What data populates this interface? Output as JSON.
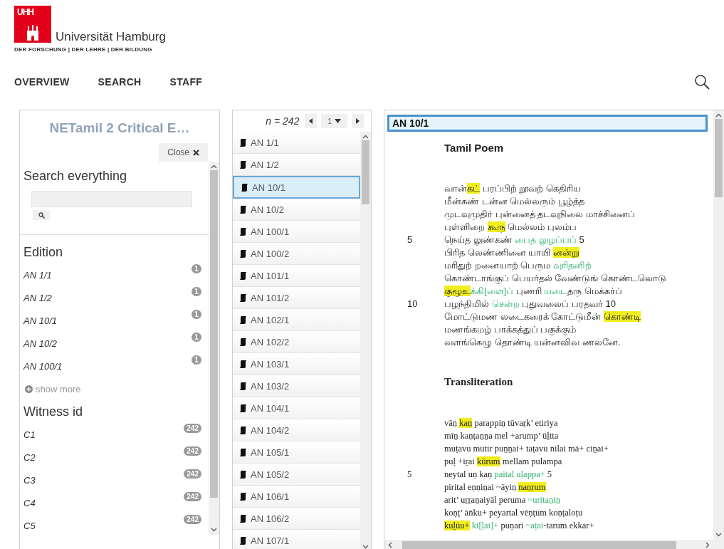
{
  "header": {
    "logo_mark": "UHH",
    "university": "Universität Hamburg",
    "tagline": "DER FORSCHUNG | DER LEHRE | DER BILDUNG"
  },
  "nav": [
    "OVERVIEW",
    "SEARCH",
    "STAFF"
  ],
  "sidebar": {
    "title": "NETamil 2 Critical E…",
    "close": "Close",
    "search_heading": "Search everything",
    "facets": [
      {
        "title": "Edition",
        "show_more": "show more",
        "items": [
          {
            "label": "AN 1/1",
            "count": "1"
          },
          {
            "label": "AN 1/2",
            "count": "1"
          },
          {
            "label": "AN 10/1",
            "count": "1"
          },
          {
            "label": "AN 10/2",
            "count": "1"
          },
          {
            "label": "AN 100/1",
            "count": "1"
          }
        ]
      },
      {
        "title": "Witness id",
        "items": [
          {
            "label": "C1",
            "count": "242"
          },
          {
            "label": "C2",
            "count": "242"
          },
          {
            "label": "C3",
            "count": "242"
          },
          {
            "label": "C4",
            "count": "242"
          },
          {
            "label": "C5",
            "count": "242"
          }
        ]
      }
    ]
  },
  "list": {
    "count": "n = 242",
    "page": "1",
    "items": [
      {
        "label": "AN 1/1",
        "selected": false
      },
      {
        "label": "AN 1/2",
        "selected": false
      },
      {
        "label": "AN 10/1",
        "selected": true
      },
      {
        "label": "AN 10/2",
        "selected": false
      },
      {
        "label": "AN 100/1",
        "selected": false
      },
      {
        "label": "AN 100/2",
        "selected": false
      },
      {
        "label": "AN 101/1",
        "selected": false
      },
      {
        "label": "AN 101/2",
        "selected": false
      },
      {
        "label": "AN 102/1",
        "selected": false
      },
      {
        "label": "AN 102/2",
        "selected": false
      },
      {
        "label": "AN 103/1",
        "selected": false
      },
      {
        "label": "AN 103/2",
        "selected": false
      },
      {
        "label": "AN 104/1",
        "selected": false
      },
      {
        "label": "AN 104/2",
        "selected": false
      },
      {
        "label": "AN 105/1",
        "selected": false
      },
      {
        "label": "AN 105/2",
        "selected": false
      },
      {
        "label": "AN 106/1",
        "selected": false
      },
      {
        "label": "AN 106/2",
        "selected": false
      },
      {
        "label": "AN 107/1",
        "selected": false
      }
    ]
  },
  "document": {
    "title": "AN 10/1",
    "sections": [
      {
        "heading": "Tamil Poem",
        "kind": "tamil",
        "lines": [
          {
            "segments": [
              {
                "kind": "plain",
                "text": "வான்"
              },
              {
                "kind": "highlight",
                "text": "கட்"
              },
              {
                "kind": "plain",
                "text": " பரப்பிற் றூவற் கெதிரிய"
              }
            ]
          },
          {
            "segments": [
              {
                "kind": "plain",
                "text": "மீன்கண் டன்ன மெல்லரும் பூழ்த்த"
              }
            ]
          },
          {
            "segments": [
              {
                "kind": "plain",
                "text": "முடவுமுதிர் புன்னைத் தடவுநிலை மாச்சினைப்"
              }
            ]
          },
          {
            "segments": [
              {
                "kind": "plain",
                "text": "புள்ளிறை "
              },
              {
                "kind": "highlight",
                "text": "கூரு"
              },
              {
                "kind": "plain",
                "text": " மெல்லம் புலம்ப"
              }
            ]
          },
          {
            "number": "5",
            "segments": [
              {
                "kind": "plain",
                "text": "நெய்த லுண்கண் "
              },
              {
                "kind": "variant",
                "text": "பைத லுழப்பப்"
              },
              {
                "kind": "plain",
                "text": " 5"
              }
            ]
          },
          {
            "segments": [
              {
                "kind": "plain",
                "text": "பிரித லெண்ணினை யாயி "
              },
              {
                "kind": "highlight",
                "text": "னன்று"
              }
            ]
          },
          {
            "segments": [
              {
                "kind": "plain",
                "text": "மரிதுற் றனையாற் பெரும "
              },
              {
                "kind": "variant",
                "text": "வுரிதனிற்"
              }
            ]
          },
          {
            "segments": [
              {
                "kind": "plain",
                "text": "கொண்டாங்குப் பெயர்தல் வேண்டுங் கொண்டலொடு"
              }
            ]
          },
          {
            "segments": [
              {
                "kind": "highlight",
                "text": "குழூஉ"
              },
              {
                "kind": "variant",
                "text": "க்கி[ளை]ப்"
              },
              {
                "kind": "plain",
                "text": " புணரி "
              },
              {
                "kind": "variant",
                "text": "யடை"
              },
              {
                "kind": "plain",
                "text": "தரு மெக்கர்ப்"
              }
            ]
          },
          {
            "number": "10",
            "segments": [
              {
                "kind": "plain",
                "text": "பழந்திமில் "
              },
              {
                "kind": "variant",
                "text": "சென்ற"
              },
              {
                "kind": "plain",
                "text": " புதுவலைப் பரதவர் 10"
              }
            ]
          },
          {
            "segments": [
              {
                "kind": "plain",
                "text": "மோட்டுமண லடைகரைக் கோட்டுமீன் "
              },
              {
                "kind": "highlight",
                "text": "கொண்டி"
              }
            ]
          },
          {
            "segments": [
              {
                "kind": "plain",
                "text": "மணங்கமழ் பாக்கத்துப் பகுக்கும்"
              }
            ]
          },
          {
            "segments": [
              {
                "kind": "plain",
                "text": "வளங்கெழு தொண்டி யன்னவிவ ணலனே."
              }
            ]
          }
        ]
      },
      {
        "heading": "Transliteration",
        "kind": "transliteration",
        "lines": [
          {
            "segments": [
              {
                "kind": "plain",
                "text": "vāṉ "
              },
              {
                "kind": "highlight",
                "text": "kaṉ"
              },
              {
                "kind": "plain",
                "text": " parappiṉ tūvaṟk’ etiriya"
              }
            ]
          },
          {
            "segments": [
              {
                "kind": "plain",
                "text": "mīṉ kaṇṭaṉṉa mel +arump’ ūḻtta"
              }
            ]
          },
          {
            "segments": [
              {
                "kind": "plain",
                "text": "muṭavu mutir puṉṉai+ taṭavu nilai mā+ ciṉai+"
              }
            ]
          },
          {
            "segments": [
              {
                "kind": "plain",
                "text": "puḷ +iṟai "
              },
              {
                "kind": "highlight",
                "text": "kūrum"
              },
              {
                "kind": "plain",
                "text": " mellam pulampa"
              }
            ]
          },
          {
            "number": "5",
            "segments": [
              {
                "kind": "plain",
                "text": "neytal uṇ kaṇ "
              },
              {
                "kind": "variant",
                "text": "paital uḻappa+"
              },
              {
                "kind": "plain",
                "text": " 5"
              }
            ]
          },
          {
            "segments": [
              {
                "kind": "plain",
                "text": "pirital eṇṇiṉai ~āyiṉ "
              },
              {
                "kind": "highlight",
                "text": "naṉṟum"
              }
            ]
          },
          {
            "segments": [
              {
                "kind": "plain",
                "text": "arit’ uṟṟaṉaiyāl peruma "
              },
              {
                "kind": "variant",
                "text": "~uritaṉiṉ"
              }
            ]
          },
          {
            "segments": [
              {
                "kind": "plain",
                "text": "koṇṭ’ āṅku+ peyartal vēṇṭum koṇṭaloṭu"
              }
            ]
          },
          {
            "segments": [
              {
                "kind": "highlight",
                "text": "kuḻūu+"
              },
              {
                "kind": "variant",
                "text": " ki[ḷai]+"
              },
              {
                "kind": "plain",
                "text": " puṇari "
              },
              {
                "kind": "variant",
                "text": "~aṭai"
              },
              {
                "kind": "plain",
                "text": "-tarum ekkar+"
              }
            ]
          }
        ]
      }
    ]
  }
}
